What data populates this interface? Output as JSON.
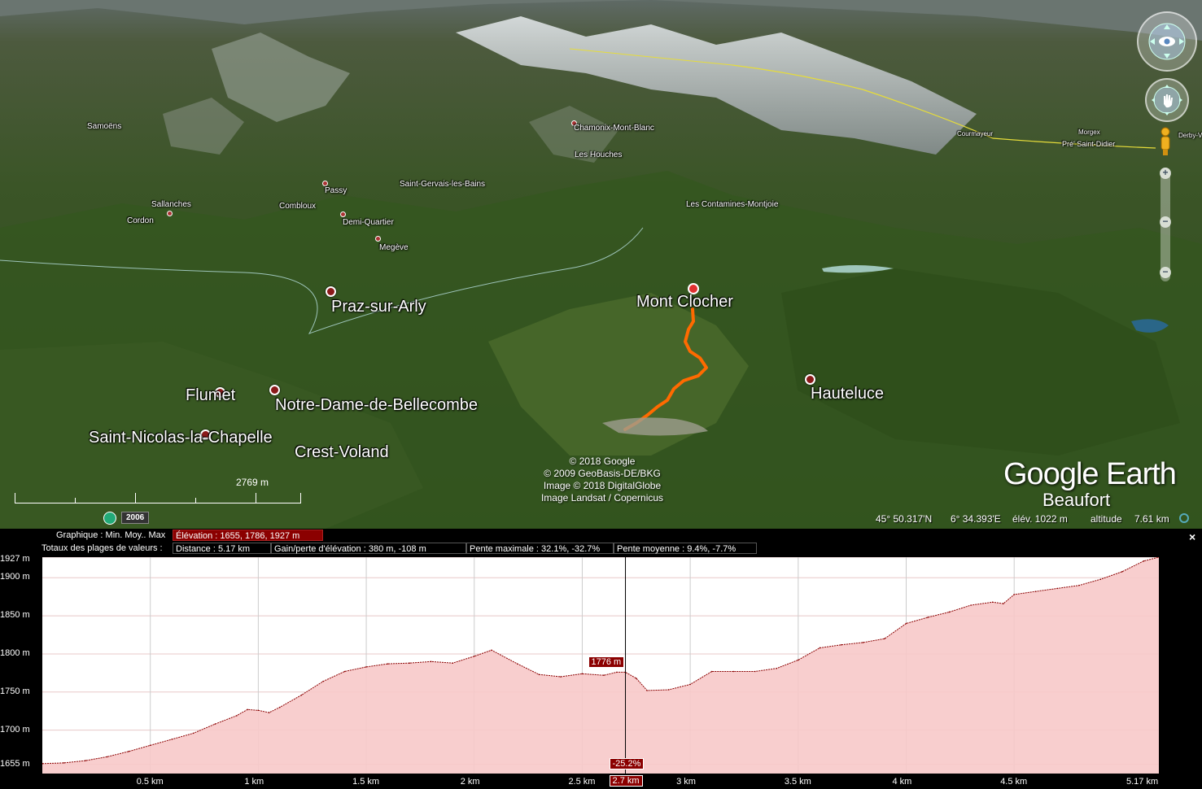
{
  "map": {
    "places": {
      "samoens": "Samoëns",
      "chamonix": "Chamonix-Mont-Blanc",
      "les_houches": "Les Houches",
      "passy": "Passy",
      "saint_gervais": "Saint-Gervais-les-Bains",
      "sallanches": "Sallanches",
      "combloux": "Combloux",
      "cordon": "Cordon",
      "demi_quartier": "Demi-Quartier",
      "megeve": "Megève",
      "les_contamines": "Les Contamines-Montjoie",
      "courmayeur": "Courmayeur",
      "morgex": "Morgex",
      "pre_saint_didier": "Pré' Saint-Didier",
      "derby": "Derby-V",
      "mont_clocher": "Mont Clocher",
      "praz_sur_arly": "Praz-sur-Arly",
      "hauteluce": "Hauteluce",
      "flumet": "Flumet",
      "notre_dame": "Notre-Dame-de-Bellecombe",
      "saint_nicolas": "Saint-Nicolas-la-Chapelle",
      "crest_voland": "Crest-Voland",
      "beaufort": "Beaufort"
    },
    "credits": [
      "© 2018 Google",
      "© 2009 GeoBasis-DE/BKG",
      "Image © 2018 DigitalGlobe",
      "Image Landsat / Copernicus"
    ],
    "logo": "Google Earth",
    "scale_label": "2769  m",
    "history_year": "2006",
    "status": {
      "lat": "45° 50.317'N",
      "lon": "6° 34.393'E",
      "elev": "élév. 1022 m",
      "altitude_label": "altitude",
      "altitude_value": "7.61 km"
    },
    "zoom_plus": "+",
    "zoom_minus": "−"
  },
  "profile": {
    "graph_label": "Graphique : Min. Moy.. Max",
    "elevation_box": "Élévation : 1655, 1786, 1927 m",
    "totals_label": "Totaux des plages de valeurs :",
    "distance_box": "Distance : 5.17 km",
    "gain_box": "Gain/perte d'élévation : 380 m, -108 m",
    "max_slope_box": "Pente maximale : 32.1%, -32.7%",
    "avg_slope_box": "Pente moyenne : 9.4%, -7.7%",
    "close": "×",
    "cursor_elev": "1776 m",
    "cursor_slope": "-25.2%",
    "cursor_dist": "2.7 km",
    "colors": {
      "fill": "#f7c9c9",
      "line": "#8b0000",
      "accent": "#8b0000"
    }
  },
  "chart_data": {
    "type": "area",
    "xlabel": "",
    "ylabel": "",
    "xlim": [
      0,
      5.17
    ],
    "ylim": [
      1643,
      1927
    ],
    "xticks": [
      0.5,
      1,
      1.5,
      2,
      2.5,
      3,
      3.5,
      4,
      4.5
    ],
    "xtick_labels": [
      "0.5 km",
      "1 km",
      "1.5 km",
      "2 km",
      "2.5 km",
      "3 km",
      "3.5 km",
      "4 km",
      "4.5 km"
    ],
    "x_end_label": "5.17 km",
    "yticks": [
      1655,
      1700,
      1750,
      1800,
      1850,
      1900,
      1927
    ],
    "ytick_labels": [
      "1655 m",
      "1700 m",
      "1750 m",
      "1800 m",
      "1850 m",
      "1900 m",
      "1927 m"
    ],
    "x": [
      0,
      0.1,
      0.2,
      0.3,
      0.4,
      0.5,
      0.6,
      0.7,
      0.8,
      0.9,
      0.95,
      1.0,
      1.05,
      1.1,
      1.2,
      1.3,
      1.4,
      1.5,
      1.6,
      1.7,
      1.8,
      1.9,
      2.0,
      2.08,
      2.2,
      2.3,
      2.4,
      2.5,
      2.6,
      2.66,
      2.7,
      2.75,
      2.8,
      2.9,
      3.0,
      3.1,
      3.2,
      3.3,
      3.4,
      3.5,
      3.6,
      3.7,
      3.8,
      3.9,
      4.0,
      4.1,
      4.2,
      4.3,
      4.4,
      4.45,
      4.5,
      4.6,
      4.7,
      4.8,
      4.9,
      5.0,
      5.1,
      5.17
    ],
    "values": [
      1656,
      1657,
      1660,
      1665,
      1672,
      1680,
      1688,
      1696,
      1708,
      1719,
      1727,
      1726,
      1723,
      1730,
      1746,
      1764,
      1777,
      1783,
      1787,
      1788,
      1790,
      1788,
      1797,
      1805,
      1787,
      1773,
      1770,
      1774,
      1772,
      1776,
      1776,
      1768,
      1752,
      1753,
      1760,
      1777,
      1777,
      1777,
      1781,
      1792,
      1808,
      1812,
      1815,
      1820,
      1840,
      1848,
      1855,
      1864,
      1868,
      1866,
      1878,
      1882,
      1886,
      1890,
      1898,
      1908,
      1922,
      1927
    ]
  }
}
